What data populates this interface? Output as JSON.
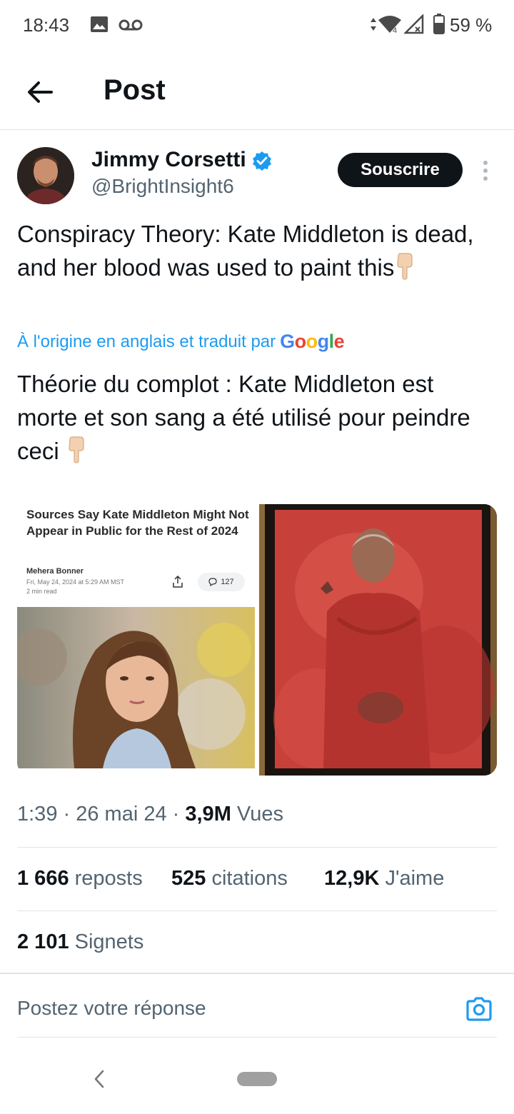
{
  "status_bar": {
    "time": "18:43",
    "battery": "59 %",
    "icons": [
      "gallery-icon",
      "voicemail-icon",
      "data-arrows-icon",
      "wifi-icon",
      "signal-icon",
      "battery-icon"
    ]
  },
  "header": {
    "title": "Post",
    "back_icon": "arrow-left-icon"
  },
  "author": {
    "name": "Jimmy Corsetti",
    "handle": "@BrightInsight6",
    "verified": true,
    "subscribe_label": "Souscrire"
  },
  "tweet": {
    "text_original": "Conspiracy Theory: Kate Middleton is dead, and her blood was used to paint this",
    "translation_note": "À l'origine en anglais et traduit par",
    "translation_provider": "Google",
    "text_translated": "Théorie du complot : Kate Middleton est morte et son sang a été utilisé pour peindre ceci"
  },
  "media": {
    "article": {
      "headline": "Sources Say Kate Middleton Might Not Appear in Public for the Rest of 2024",
      "author": "Mehera Bonner",
      "date": "Fri, May 24, 2024 at 5:29 AM MST",
      "read_time": "2 min read",
      "comment_count": "127"
    }
  },
  "meta": {
    "time": "1:39",
    "date": "26 mai 24",
    "views_value": "3,9M",
    "views_label": "Vues"
  },
  "stats": {
    "reposts_value": "1 666",
    "reposts_label": "reposts",
    "quotes_value": "525",
    "quotes_label": "citations",
    "likes_value": "12,9K",
    "likes_label": "J'aime",
    "bookmarks_value": "2 101",
    "bookmarks_label": "Signets"
  },
  "reply": {
    "placeholder": "Postez votre réponse"
  },
  "colors": {
    "accent": "#1d9bf0",
    "text_primary": "#0f1419",
    "text_secondary": "#536471",
    "button_dark": "#0f1419"
  }
}
